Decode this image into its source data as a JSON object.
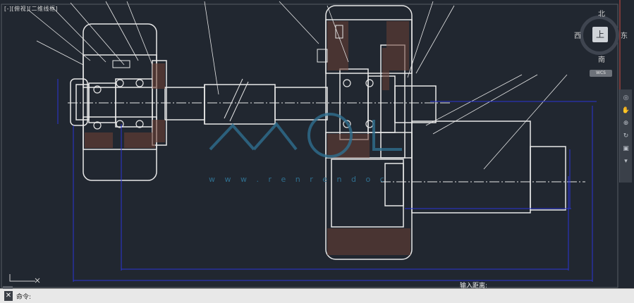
{
  "viewport": {
    "view_controls": "[-][俯视][二维线框]",
    "compass": {
      "north": "北",
      "south": "南",
      "east": "东",
      "west": "西",
      "top_button": "上"
    },
    "wcs_label": "WCS",
    "watermark_text": "w w w . r e n r e n d o c"
  },
  "drawing": {
    "dimension_note": "输入距离:"
  },
  "command_line": {
    "close_glyph": "✕",
    "prompt": "命令:"
  },
  "colors": {
    "background": "#212730",
    "line_white": "#e8e8e8",
    "dimension_blue": "#2a36d6",
    "watermark": "#2f6f8f"
  }
}
